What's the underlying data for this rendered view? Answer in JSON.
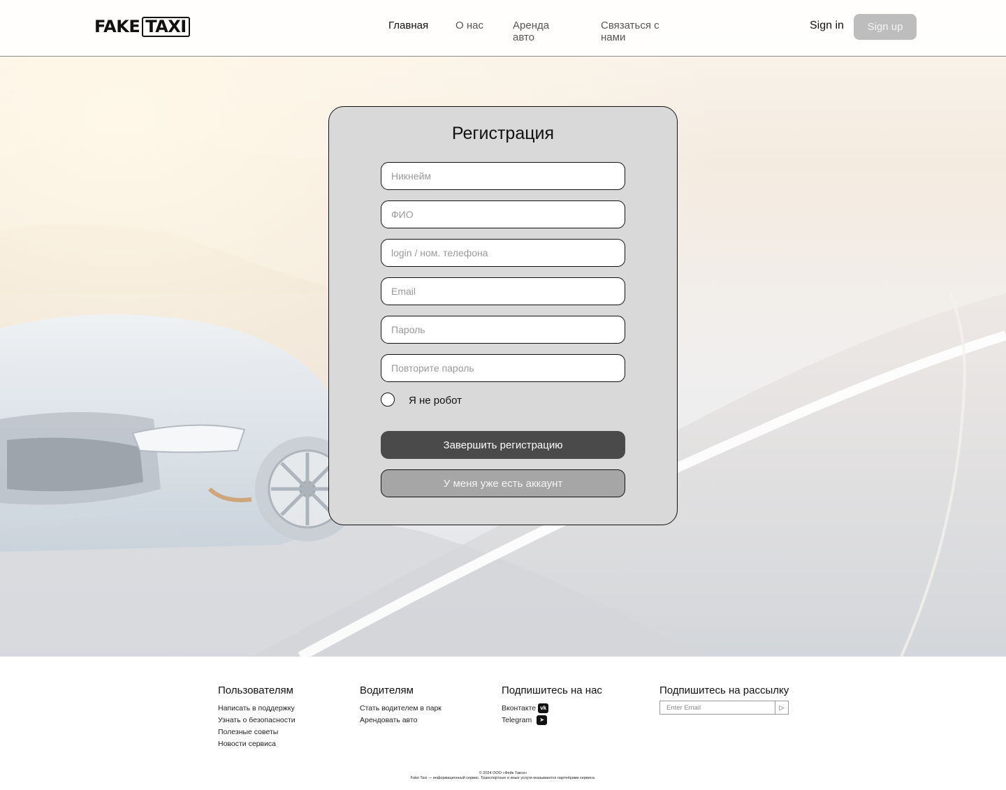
{
  "logo": {
    "fake": "FAKE",
    "taxi": "TAXI"
  },
  "nav": {
    "items": [
      {
        "label": "Главная"
      },
      {
        "label": "О нас"
      },
      {
        "label": "Аренда авто"
      },
      {
        "label": "Связаться с нами"
      }
    ],
    "signin": "Sign in",
    "signup": "Sign up"
  },
  "form": {
    "title": "Регистрация",
    "fields": [
      {
        "placeholder": "Никнейм"
      },
      {
        "placeholder": "ФИО"
      },
      {
        "placeholder": "login / ном. телефона"
      },
      {
        "placeholder": "Email"
      },
      {
        "placeholder": "Пароль"
      },
      {
        "placeholder": "Повторите пароль"
      }
    ],
    "captcha_label": "Я не робот",
    "submit_label": "Завершить регистрацию",
    "have_account_label": "У меня уже есть аккаунт"
  },
  "footer": {
    "users": {
      "heading": "Пользователям",
      "links": [
        "Написать в поддержку",
        "Узнать о безопасности",
        "Полезные советы",
        "Новости сервиса"
      ]
    },
    "drivers": {
      "heading": "Водителям",
      "links": [
        "Стать водителем в парк",
        "Арендовать авто"
      ]
    },
    "social": {
      "heading": "Подпишитесь на нас",
      "links": [
        {
          "label": "Вконтакте",
          "icon": "vk-icon"
        },
        {
          "label": "Telegram",
          "icon": "telegram-icon"
        }
      ]
    },
    "newsletter": {
      "heading": "Подпишитесь на рассылку",
      "placeholder": "Enter Email",
      "submit_icon": "send-icon"
    },
    "copyright_line1": "© 2024 ООО «Фейк Такси»",
    "copyright_line2": "Fake Taxi — информационный сервис. Транспортные и иные услуги оказываются партнёрами сервиса."
  },
  "colors": {
    "card_bg": "#d9d9d9",
    "primary_button": "#4a4a4a",
    "secondary_button": "#a6a6a6",
    "signup_button": "#bdbdbd"
  }
}
